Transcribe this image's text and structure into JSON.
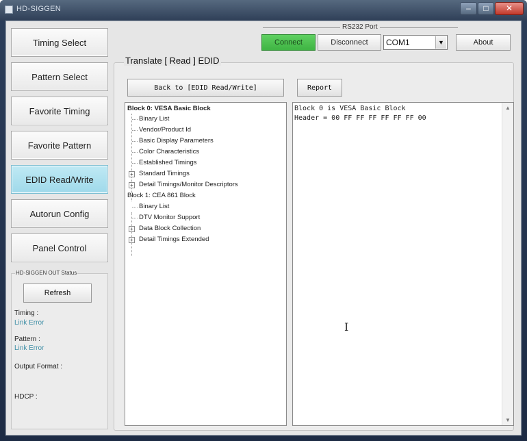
{
  "window": {
    "title": "HD-SIGGEN"
  },
  "nav": {
    "items": [
      {
        "label": "Timing Select"
      },
      {
        "label": "Pattern Select"
      },
      {
        "label": "Favorite Timing"
      },
      {
        "label": "Favorite Pattern"
      },
      {
        "label": "EDID Read/Write"
      },
      {
        "label": "Autorun Config"
      },
      {
        "label": "Panel Control"
      }
    ],
    "active_index": 4
  },
  "status": {
    "legend": "HD-SIGGEN OUT Status",
    "refresh_label": "Refresh",
    "timing_label": "Timing :",
    "timing_value": "Link Error",
    "pattern_label": "Pattern :",
    "pattern_value": "Link Error",
    "output_format_label": "Output Format :",
    "hdcp_label": "HDCP :"
  },
  "port": {
    "group_label": "RS232 Port",
    "connect_label": "Connect",
    "disconnect_label": "Disconnect",
    "selected_port": "COM1",
    "about_label": "About"
  },
  "translate": {
    "title": "Translate [ Read ] EDID",
    "back_label": "Back to [EDID Read/Write]",
    "report_label": "Report",
    "tree": [
      {
        "label": "Block 0: VESA Basic Block",
        "bold": true
      },
      {
        "label": "Binary List"
      },
      {
        "label": "Vendor/Product Id"
      },
      {
        "label": "Basic Display Parameters"
      },
      {
        "label": "Color Characteristics"
      },
      {
        "label": "Established Timings"
      },
      {
        "label": "Standard Timings",
        "expandable": true
      },
      {
        "label": "Detail Timings/Monitor Descriptors",
        "expandable": true
      },
      {
        "label": "Block 1: CEA 861 Block"
      },
      {
        "label": "Binary List"
      },
      {
        "label": "DTV Monitor Support"
      },
      {
        "label": "Data Block Collection",
        "expandable": true
      },
      {
        "label": "Detail Timings Extended",
        "expandable": true
      }
    ],
    "output_lines": [
      "Block 0 is VESA Basic Block",
      "Header = 00 FF FF FF FF FF FF 00"
    ]
  },
  "colors": {
    "connect_green": "#3fb443",
    "active_nav": "#9fd9ea",
    "error_text": "#3f8fa6"
  }
}
